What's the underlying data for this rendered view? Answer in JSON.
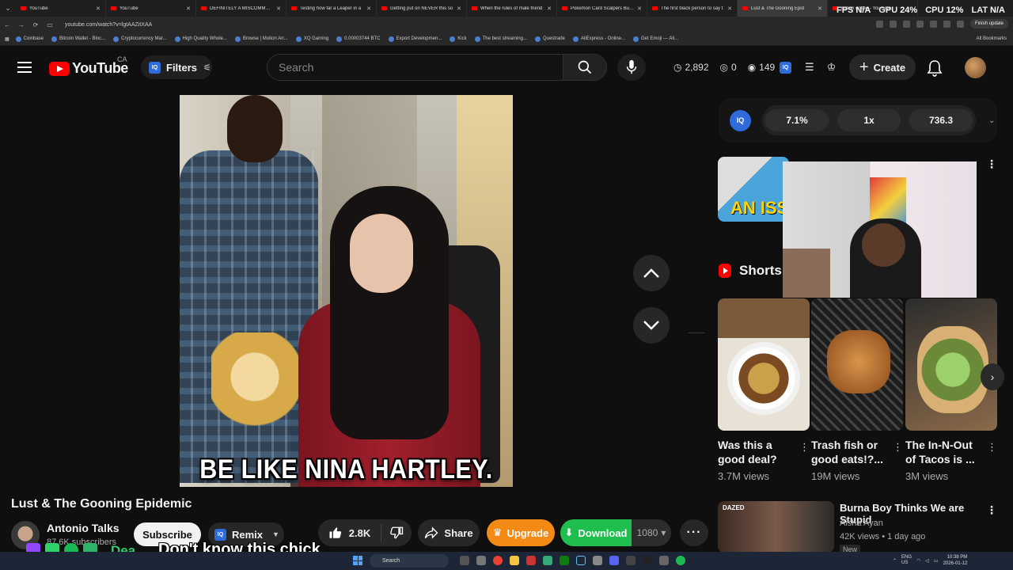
{
  "browser": {
    "tabs": [
      {
        "label": "YouTube",
        "active": false
      },
      {
        "label": "YouTube",
        "active": false
      },
      {
        "label": "DEFINITELY A MISCOMMUNI",
        "active": false
      },
      {
        "label": "Testing how far a Leaper in a",
        "active": false
      },
      {
        "label": "Getting put on NEVER this so",
        "active": false
      },
      {
        "label": "When the rules of male friend",
        "active": false
      },
      {
        "label": "Pokemon Card Scalpers But T",
        "active": false
      },
      {
        "label": "The first black person to say t",
        "active": false
      },
      {
        "label": "Lust & The Gooning Epid",
        "active": true
      },
      {
        "label": "cuban coffee - YouTube",
        "active": false
      }
    ],
    "url": "youtube.com/watch?v=lgtAAZitXAA",
    "finish_update": "Finish update",
    "bookmarks": [
      "Coinbase",
      "Bitcoin Wallet - Bloc...",
      "Cryptocurrency Mar...",
      "High Quality Whole...",
      "Browse | Motion Arr...",
      "XQ Gaming",
      "0.00003744 BTC",
      "Export Developmen...",
      "Kick",
      "The best streaming...",
      "Questrade",
      "AliExpress - Online...",
      "Get Emoji — All..."
    ],
    "all_bookmarks": "All Bookmarks"
  },
  "perf_overlay": {
    "fps_label": "FPS",
    "fps_value": "N/A",
    "gpu_label": "GPU",
    "gpu_value": "24%",
    "cpu_label": "CPU",
    "cpu_value": "12%",
    "lat_label": "LAT",
    "lat_value": "N/A"
  },
  "header": {
    "logo_text": "YouTube",
    "country": "CA",
    "filters_label": "Filters",
    "iq_label": "IQ",
    "search_placeholder": "Search",
    "stat_views": "2,892",
    "stat_hidden": "0",
    "stat_watch": "149",
    "create_label": "Create"
  },
  "video": {
    "caption": "BE LIKE NINA HARTLEY.",
    "title": "Lust & The Gooning Epidemic",
    "channel": "Antonio Talks",
    "subscribers": "87.6K subscribers",
    "subscribe_label": "Subscribe",
    "remix_label": "Remix",
    "likes": "2.8K",
    "share_label": "Share",
    "upgrade_label": "Upgrade",
    "download_label": "Download",
    "quality": "1080"
  },
  "stream_overlay": {
    "chat_prefix": "Dea...",
    "caption": "Don't know this chick"
  },
  "iq_panel": {
    "badge": "IQ",
    "pill_1": "7.1%",
    "pill_2": "1x",
    "pill_3": "736.3"
  },
  "recommendations": {
    "first_thumb_text": "AN ISS",
    "shorts_heading": "Shorts",
    "shorts": [
      {
        "title": "Was this a good deal?",
        "views": "3.7M views"
      },
      {
        "title": "Trash fish or good eats!?...",
        "views": "19M views"
      },
      {
        "title": "The In-N-Out of Tacos is ...",
        "views": "3M views"
      }
    ],
    "video_2": {
      "thumb_text": "DAZED",
      "title": "Burna Boy Thinks We are Stupid",
      "channel": "Aisha Ayan",
      "meta": "42K views • 1 day ago",
      "badge": "New"
    }
  },
  "taskbar": {
    "search_label": "Search",
    "lang": "ENG\nUS",
    "time": "10:38 PM",
    "date": "2026-01-12"
  },
  "colors": {
    "background": "#0f0f0f",
    "youtube_red": "#ff0000",
    "upgrade_orange": "#f48a16",
    "download_green": "#1fbf4f",
    "iq_blue": "#2f6bdb"
  }
}
